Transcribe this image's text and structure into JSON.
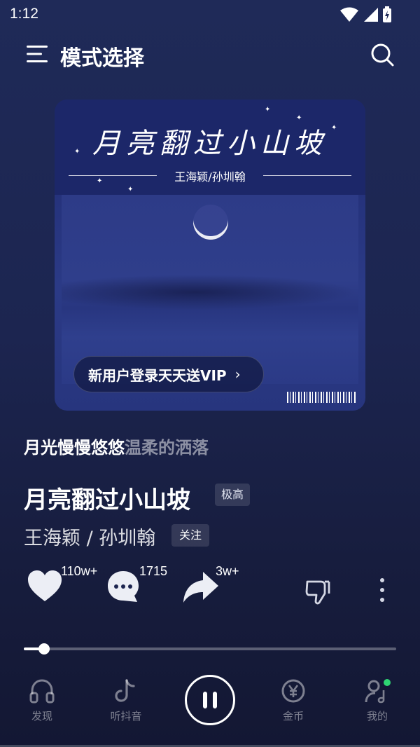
{
  "status_bar": {
    "time": "1:12"
  },
  "header": {
    "title": "模式选择",
    "menu_icon": "menu-icon",
    "search_icon": "search-icon"
  },
  "cover": {
    "title": "月亮翻过小山坡",
    "artist": "王海颖/孙圳翰",
    "vip_banner": "新用户登录天天送VIP",
    "vip_chevron": "›"
  },
  "lyric": {
    "highlighted": "月光慢慢悠悠",
    "dimmed": "温柔的洒落"
  },
  "song": {
    "title": "月亮翻过小山坡",
    "quality": "极高",
    "artist": "王海颖 / 孙圳翰",
    "follow": "关注"
  },
  "actions": {
    "like_count": "110w+",
    "comment_count": "1715",
    "share_count": "3w+"
  },
  "progress": {
    "played_fraction": 0.055
  },
  "nav": {
    "items": [
      {
        "label": "发现",
        "icon": "headphones-icon"
      },
      {
        "label": "听抖音",
        "icon": "tiktok-icon"
      },
      {
        "label": "",
        "icon": "pause-icon"
      },
      {
        "label": "金币",
        "icon": "coin-icon"
      },
      {
        "label": "我的",
        "icon": "profile-music-icon"
      }
    ]
  },
  "colors": {
    "background": "#1f2a58",
    "badge_dot": "#2ed573"
  }
}
